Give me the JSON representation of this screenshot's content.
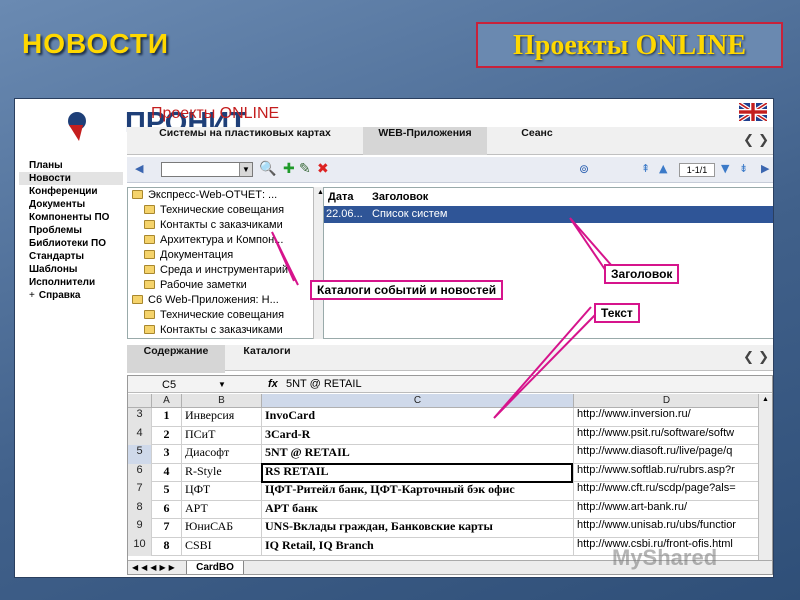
{
  "slide": {
    "title": "НОВОСТИ",
    "app_title": "Проекты ONLINE"
  },
  "header": {
    "logo_text": "ПРОНИТ",
    "title": "Проекты ONLINE"
  },
  "top_tabs": [
    {
      "label": "Системы на пластиковых картах",
      "active": false
    },
    {
      "label": "WEB-Приложения",
      "active": true
    },
    {
      "label": "Сеанс",
      "active": false
    }
  ],
  "left_nav": [
    {
      "label": "Планы",
      "selected": false
    },
    {
      "label": "Новости",
      "selected": true
    },
    {
      "label": "Конференции",
      "selected": false
    },
    {
      "label": "Документы",
      "selected": false
    },
    {
      "label": "Компоненты ПО",
      "selected": false
    },
    {
      "label": "Проблемы",
      "selected": false
    },
    {
      "label": "Библиотеки ПО",
      "selected": false
    },
    {
      "label": "Стандарты",
      "selected": false
    },
    {
      "label": "Шаблоны",
      "selected": false
    },
    {
      "label": "Исполнители",
      "selected": false
    },
    {
      "label": "Справка",
      "selected": false,
      "prefix": "+"
    }
  ],
  "toolbar": {
    "pager": "1-1/1"
  },
  "tree": [
    {
      "label": "Экспресс-Web-ОТЧЕТ: ...",
      "level": 0
    },
    {
      "label": "Технические совещания",
      "level": 1
    },
    {
      "label": "Контакты с заказчиками",
      "level": 1
    },
    {
      "label": "Архитектура и Компон...",
      "level": 1
    },
    {
      "label": "Документация",
      "level": 1
    },
    {
      "label": "Среда и инструментарий",
      "level": 1
    },
    {
      "label": "Рабочие заметки",
      "level": 1
    },
    {
      "label": "С6 Web-Приложения: Н...",
      "level": 0
    },
    {
      "label": "Технические совещания",
      "level": 1
    },
    {
      "label": "Контакты с заказчиками",
      "level": 1
    }
  ],
  "messages": {
    "headers": {
      "date": "Дата",
      "subject": "Заголовок"
    },
    "rows": [
      {
        "date": "22.06...",
        "subject": "Список систем"
      }
    ]
  },
  "bottom_tabs": [
    {
      "label": "Содержание",
      "active": true
    },
    {
      "label": "Каталоги",
      "active": false
    }
  ],
  "sheet": {
    "name_box": "C5",
    "fx": "fx",
    "formula": "5NT @ RETAIL",
    "columns": [
      "A",
      "B",
      "C",
      "D"
    ],
    "rows": [
      {
        "rn": "3",
        "a": "1",
        "b": "Инверсия",
        "c": "InvoCard",
        "d": "http://www.inversion.ru/"
      },
      {
        "rn": "4",
        "a": "2",
        "b": "ПСиТ",
        "c": "3Card-R",
        "d": "http://www.psit.ru/software/softw"
      },
      {
        "rn": "5",
        "a": "3",
        "b": "Диасофт",
        "c": "5NT @ RETAIL",
        "d": "http://www.diasoft.ru/live/page/q"
      },
      {
        "rn": "6",
        "a": "4",
        "b": "R-Style",
        "c": "RS RETAIL",
        "d": "http://www.softlab.ru/rubrs.asp?r"
      },
      {
        "rn": "7",
        "a": "5",
        "b": "ЦФТ",
        "c": "ЦФТ-Ритейл банк, ЦФТ-Карточный бэк офис",
        "d": "http://www.cft.ru/scdp/page?als="
      },
      {
        "rn": "8",
        "a": "6",
        "b": "АРТ",
        "c": "АРТ банк",
        "d": "http://www.art-bank.ru/"
      },
      {
        "rn": "9",
        "a": "7",
        "b": "ЮниСАБ",
        "c": "UNS-Вклады граждан, Банковские карты",
        "d": "http://www.unisab.ru/ubs/functior"
      },
      {
        "rn": "10",
        "a": "8",
        "b": "CSBI",
        "c": "IQ Retail, IQ Branch",
        "d": "http://www.csbi.ru/front-ofis.html"
      }
    ],
    "sheet_tab": "CardBO"
  },
  "callouts": {
    "catalogs": "Каталоги событий и новостей",
    "heading": "Заголовок",
    "text": "Текст"
  },
  "watermark": "MyShared",
  "colors": {
    "slide_title": "#ffd800",
    "callout_border": "#d6148c",
    "selection": "#2f5597",
    "header_title": "#c41e1e"
  }
}
